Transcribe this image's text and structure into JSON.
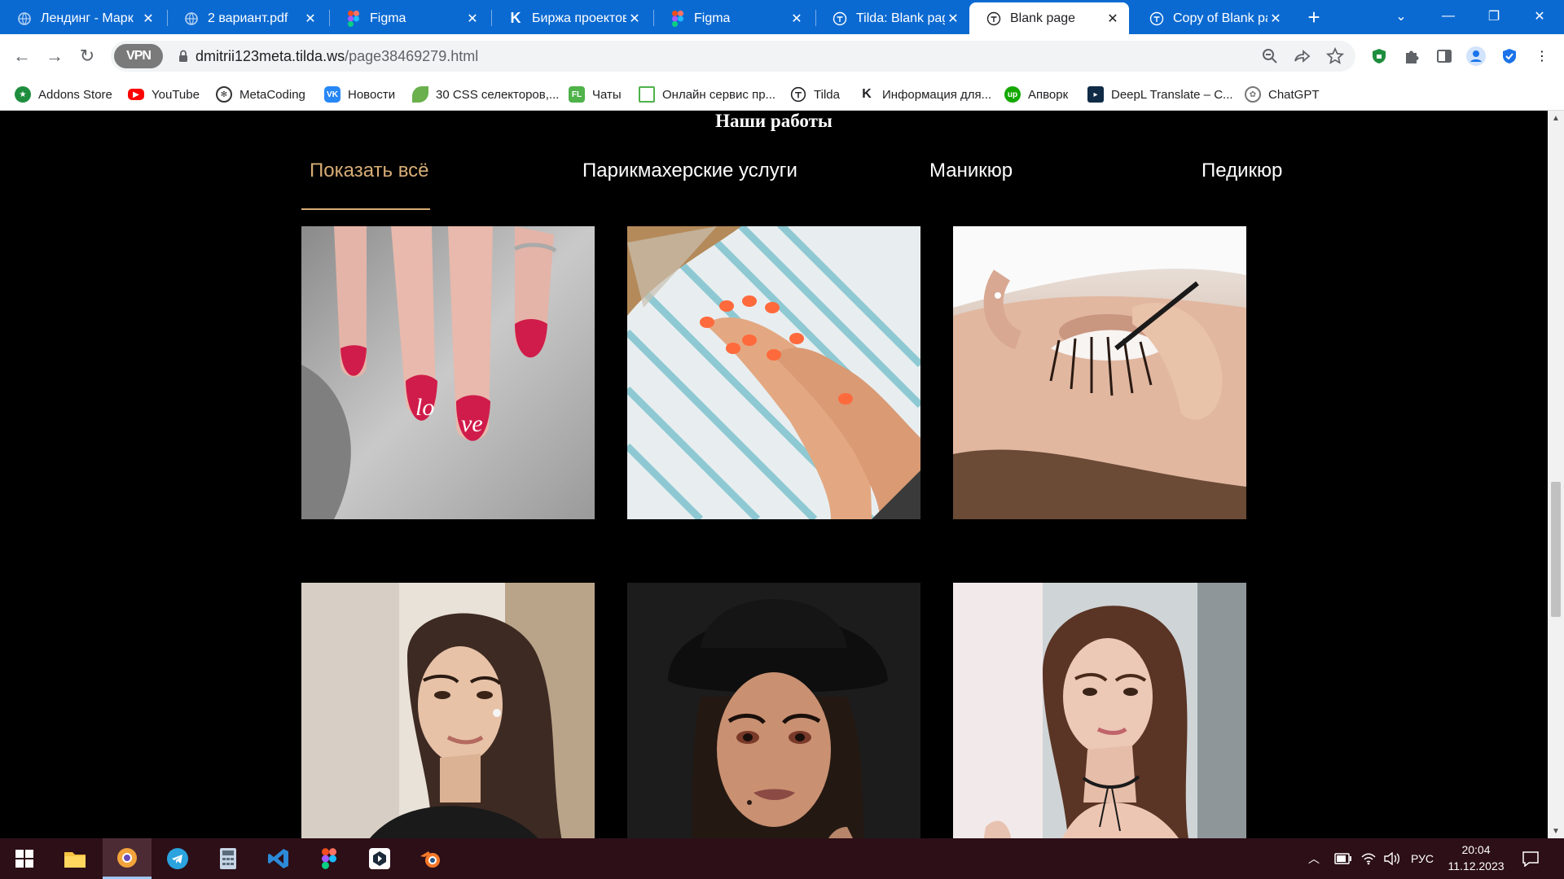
{
  "browser": {
    "tabs": [
      {
        "title": "Лендинг - Марк",
        "icon": "globe-icon",
        "active": false
      },
      {
        "title": "2 вариант.pdf",
        "icon": "pdf-icon",
        "active": false
      },
      {
        "title": "Figma",
        "icon": "figma-icon",
        "active": false
      },
      {
        "title": "Биржа проектов",
        "icon": "kwork-icon",
        "active": false
      },
      {
        "title": "Figma",
        "icon": "figma-icon",
        "active": false
      },
      {
        "title": "Tilda: Blank page",
        "icon": "tilda-icon",
        "active": false
      },
      {
        "title": "Blank page",
        "icon": "tilda-icon",
        "active": true
      },
      {
        "title": "Copy of Blank page",
        "icon": "tilda-icon",
        "active": false
      }
    ],
    "new_tab_label": "+",
    "vpn_label": "VPN",
    "url_host": "dmitrii123meta.tilda.ws",
    "url_path": "/page38469279.html",
    "bookmarks": [
      {
        "label": "Addons Store",
        "icon": "addons-store-icon"
      },
      {
        "label": "YouTube",
        "icon": "youtube-icon"
      },
      {
        "label": "MetaCoding",
        "icon": "metacoding-icon"
      },
      {
        "label": "Новости",
        "icon": "vk-icon"
      },
      {
        "label": "30 CSS селекторов,...",
        "icon": "leaf-icon"
      },
      {
        "label": "Чаты",
        "icon": "fl-icon"
      },
      {
        "label": "Онлайн сервис пр...",
        "icon": "frame-icon"
      },
      {
        "label": "Tilda",
        "icon": "tilda-icon"
      },
      {
        "label": "Информация для...",
        "icon": "kwork-icon"
      },
      {
        "label": "Апворк",
        "icon": "upwork-icon"
      },
      {
        "label": "DeepL Translate – С...",
        "icon": "deepl-icon"
      },
      {
        "label": "ChatGPT",
        "icon": "chatgpt-icon"
      }
    ]
  },
  "page": {
    "title": "Наши работы",
    "filters": [
      {
        "label": "Показать всё",
        "active": true
      },
      {
        "label": "Парикмахерские услуги",
        "active": false
      },
      {
        "label": "Маникюр",
        "active": false
      },
      {
        "label": "Педикюр",
        "active": false
      }
    ],
    "gallery": [
      {
        "subject": "red-love-manicure"
      },
      {
        "subject": "coral-manicure-on-towel"
      },
      {
        "subject": "eyelash-extension"
      },
      {
        "subject": "portrait-woman-black-jacket"
      },
      {
        "subject": "portrait-woman-black-hat"
      },
      {
        "subject": "portrait-woman-choker"
      }
    ],
    "accent_color": "#d7ad75"
  },
  "taskbar": {
    "apps": [
      "windows-start-icon",
      "file-explorer-icon",
      "browser-icon",
      "telegram-icon",
      "calculator-icon",
      "vscode-icon",
      "figma-icon",
      "app-icon",
      "blender-icon"
    ],
    "language": "РУС",
    "time": "20:04",
    "date": "11.12.2023"
  }
}
